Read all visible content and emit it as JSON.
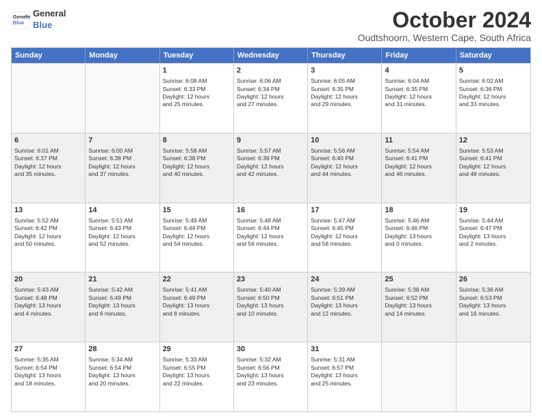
{
  "logo": {
    "line1": "General",
    "line2": "Blue"
  },
  "title": "October 2024",
  "subtitle": "Oudtshoorn, Western Cape, South Africa",
  "headers": [
    "Sunday",
    "Monday",
    "Tuesday",
    "Wednesday",
    "Thursday",
    "Friday",
    "Saturday"
  ],
  "weeks": [
    [
      {
        "day": "",
        "info": "",
        "empty": true
      },
      {
        "day": "",
        "info": "",
        "empty": true
      },
      {
        "day": "1",
        "info": "Sunrise: 6:08 AM\nSunset: 6:33 PM\nDaylight: 12 hours\nand 25 minutes."
      },
      {
        "day": "2",
        "info": "Sunrise: 6:06 AM\nSunset: 6:34 PM\nDaylight: 12 hours\nand 27 minutes."
      },
      {
        "day": "3",
        "info": "Sunrise: 6:05 AM\nSunset: 6:35 PM\nDaylight: 12 hours\nand 29 minutes."
      },
      {
        "day": "4",
        "info": "Sunrise: 6:04 AM\nSunset: 6:35 PM\nDaylight: 12 hours\nand 31 minutes."
      },
      {
        "day": "5",
        "info": "Sunrise: 6:02 AM\nSunset: 6:36 PM\nDaylight: 12 hours\nand 33 minutes."
      }
    ],
    [
      {
        "day": "6",
        "info": "Sunrise: 6:01 AM\nSunset: 6:37 PM\nDaylight: 12 hours\nand 35 minutes.",
        "shaded": true
      },
      {
        "day": "7",
        "info": "Sunrise: 6:00 AM\nSunset: 6:38 PM\nDaylight: 12 hours\nand 37 minutes.",
        "shaded": true
      },
      {
        "day": "8",
        "info": "Sunrise: 5:58 AM\nSunset: 6:38 PM\nDaylight: 12 hours\nand 40 minutes.",
        "shaded": true
      },
      {
        "day": "9",
        "info": "Sunrise: 5:57 AM\nSunset: 6:39 PM\nDaylight: 12 hours\nand 42 minutes.",
        "shaded": true
      },
      {
        "day": "10",
        "info": "Sunrise: 5:56 AM\nSunset: 6:40 PM\nDaylight: 12 hours\nand 44 minutes.",
        "shaded": true
      },
      {
        "day": "11",
        "info": "Sunrise: 5:54 AM\nSunset: 6:41 PM\nDaylight: 12 hours\nand 46 minutes.",
        "shaded": true
      },
      {
        "day": "12",
        "info": "Sunrise: 5:53 AM\nSunset: 6:41 PM\nDaylight: 12 hours\nand 48 minutes.",
        "shaded": true
      }
    ],
    [
      {
        "day": "13",
        "info": "Sunrise: 5:52 AM\nSunset: 6:42 PM\nDaylight: 12 hours\nand 50 minutes."
      },
      {
        "day": "14",
        "info": "Sunrise: 5:51 AM\nSunset: 6:43 PM\nDaylight: 12 hours\nand 52 minutes."
      },
      {
        "day": "15",
        "info": "Sunrise: 5:49 AM\nSunset: 6:44 PM\nDaylight: 12 hours\nand 54 minutes."
      },
      {
        "day": "16",
        "info": "Sunrise: 5:48 AM\nSunset: 6:44 PM\nDaylight: 12 hours\nand 56 minutes."
      },
      {
        "day": "17",
        "info": "Sunrise: 5:47 AM\nSunset: 6:45 PM\nDaylight: 12 hours\nand 58 minutes."
      },
      {
        "day": "18",
        "info": "Sunrise: 5:46 AM\nSunset: 6:46 PM\nDaylight: 13 hours\nand 0 minutes."
      },
      {
        "day": "19",
        "info": "Sunrise: 5:44 AM\nSunset: 6:47 PM\nDaylight: 13 hours\nand 2 minutes."
      }
    ],
    [
      {
        "day": "20",
        "info": "Sunrise: 5:43 AM\nSunset: 6:48 PM\nDaylight: 13 hours\nand 4 minutes.",
        "shaded": true
      },
      {
        "day": "21",
        "info": "Sunrise: 5:42 AM\nSunset: 6:49 PM\nDaylight: 13 hours\nand 6 minutes.",
        "shaded": true
      },
      {
        "day": "22",
        "info": "Sunrise: 5:41 AM\nSunset: 6:49 PM\nDaylight: 13 hours\nand 8 minutes.",
        "shaded": true
      },
      {
        "day": "23",
        "info": "Sunrise: 5:40 AM\nSunset: 6:50 PM\nDaylight: 13 hours\nand 10 minutes.",
        "shaded": true
      },
      {
        "day": "24",
        "info": "Sunrise: 5:39 AM\nSunset: 6:51 PM\nDaylight: 13 hours\nand 12 minutes.",
        "shaded": true
      },
      {
        "day": "25",
        "info": "Sunrise: 5:38 AM\nSunset: 6:52 PM\nDaylight: 13 hours\nand 14 minutes.",
        "shaded": true
      },
      {
        "day": "26",
        "info": "Sunrise: 5:36 AM\nSunset: 6:53 PM\nDaylight: 13 hours\nand 16 minutes.",
        "shaded": true
      }
    ],
    [
      {
        "day": "27",
        "info": "Sunrise: 5:35 AM\nSunset: 6:54 PM\nDaylight: 13 hours\nand 18 minutes."
      },
      {
        "day": "28",
        "info": "Sunrise: 5:34 AM\nSunset: 6:54 PM\nDaylight: 13 hours\nand 20 minutes."
      },
      {
        "day": "29",
        "info": "Sunrise: 5:33 AM\nSunset: 6:55 PM\nDaylight: 13 hours\nand 22 minutes."
      },
      {
        "day": "30",
        "info": "Sunrise: 5:32 AM\nSunset: 6:56 PM\nDaylight: 13 hours\nand 23 minutes."
      },
      {
        "day": "31",
        "info": "Sunrise: 5:31 AM\nSunset: 6:57 PM\nDaylight: 13 hours\nand 25 minutes."
      },
      {
        "day": "",
        "info": "",
        "empty": true
      },
      {
        "day": "",
        "info": "",
        "empty": true
      }
    ]
  ]
}
